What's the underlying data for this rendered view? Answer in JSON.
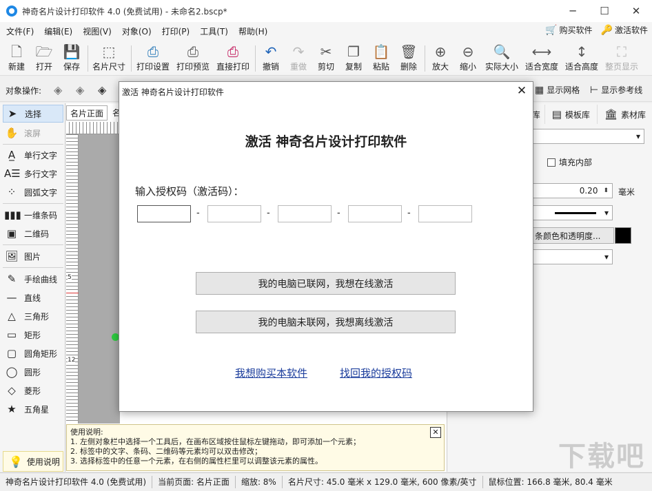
{
  "window": {
    "title": "神奇名片设计打印软件 4.0 (免费试用) - 未命名2.bscp*",
    "icon": "app-logo-icon",
    "controls": [
      "─",
      "☐",
      "✕"
    ]
  },
  "menu": {
    "items": [
      "文件(F)",
      "编辑(E)",
      "视图(V)",
      "对象(O)",
      "打印(P)",
      "工具(T)",
      "帮助(H)"
    ],
    "buy": "购买软件",
    "activate": "激活软件"
  },
  "toolbar": {
    "buttons": [
      {
        "label": "新建",
        "icon": "new-file-icon"
      },
      {
        "label": "打开",
        "icon": "open-icon"
      },
      {
        "label": "保存",
        "icon": "save-icon"
      },
      {
        "label": "名片尺寸",
        "icon": "card-size-icon"
      },
      {
        "label": "打印设置",
        "icon": "print-settings-icon"
      },
      {
        "label": "打印预览",
        "icon": "print-preview-icon"
      },
      {
        "label": "直接打印",
        "icon": "print-icon"
      },
      {
        "label": "撤销",
        "icon": "undo-icon"
      },
      {
        "label": "重做",
        "icon": "redo-icon"
      },
      {
        "label": "剪切",
        "icon": "cut-icon"
      },
      {
        "label": "复制",
        "icon": "copy-icon"
      },
      {
        "label": "粘贴",
        "icon": "paste-icon"
      },
      {
        "label": "删除",
        "icon": "delete-icon"
      },
      {
        "label": "放大",
        "icon": "zoom-in-icon"
      },
      {
        "label": "缩小",
        "icon": "zoom-out-icon"
      },
      {
        "label": "实际大小",
        "icon": "actual-size-icon"
      },
      {
        "label": "适合宽度",
        "icon": "fit-width-icon"
      },
      {
        "label": "适合高度",
        "icon": "fit-height-icon"
      },
      {
        "label": "整页显示",
        "icon": "fit-page-icon"
      }
    ]
  },
  "objbar": {
    "label": "对象操作:",
    "show_grid": "显示网格",
    "show_guides": "显示参考线"
  },
  "tools": {
    "items": [
      "选择",
      "滚屏",
      "单行文字",
      "多行文字",
      "圆弧文字",
      "一维条码",
      "二维码",
      "图片",
      "手绘曲线",
      "直线",
      "三角形",
      "矩形",
      "圆角矩形",
      "圆形",
      "菱形",
      "五角星"
    ],
    "help_button": "使用说明"
  },
  "canvas": {
    "tabs": [
      "名片正面",
      "名"
    ],
    "ruler_labels": [
      "5",
      "12"
    ]
  },
  "help_box": {
    "title": "使用说明:",
    "lines": [
      "1. 左侧对象栏中选择一个工具后，在画布区域按住鼠标左键拖动，即可添加一个元素；",
      "2. 标签中的文字、条码、二维码等元素均可以双击修改；",
      "3. 选择标签中的任意一个元素，在右侧的属性栏里可以调整该元素的属性。"
    ],
    "close": "✕"
  },
  "right_panel": {
    "tabs": [
      "库",
      "模板库",
      "素材库"
    ],
    "fill_label": "填充内部",
    "line_width": "0.20",
    "unit": "毫米",
    "color_button": "条颜色和透明度...",
    "color_value": "#000000"
  },
  "status": {
    "app": "神奇名片设计打印软件 4.0 (免费试用)",
    "page": "当前页面: 名片正面",
    "zoom": "缩放: 8%",
    "size": "名片尺寸: 45.0 毫米 x 129.0 毫米, 600 像素/英寸",
    "mouse": "鼠标位置: 166.8 毫米, 80.4 毫米"
  },
  "dialog": {
    "title": "激活 神奇名片设计打印软件",
    "close": "✕",
    "heading": "激活 神奇名片设计打印软件",
    "code_label": "输入授权码（激活码）：",
    "code_values": [
      "",
      "",
      "",
      "",
      ""
    ],
    "dash": "-",
    "online_button": "我的电脑已联网，我想在线激活",
    "offline_button": "我的电脑未联网，我想离线激活",
    "buy_link": "我想购买本软件",
    "recover_link": "找回我的授权码"
  },
  "watermark": "下载吧"
}
